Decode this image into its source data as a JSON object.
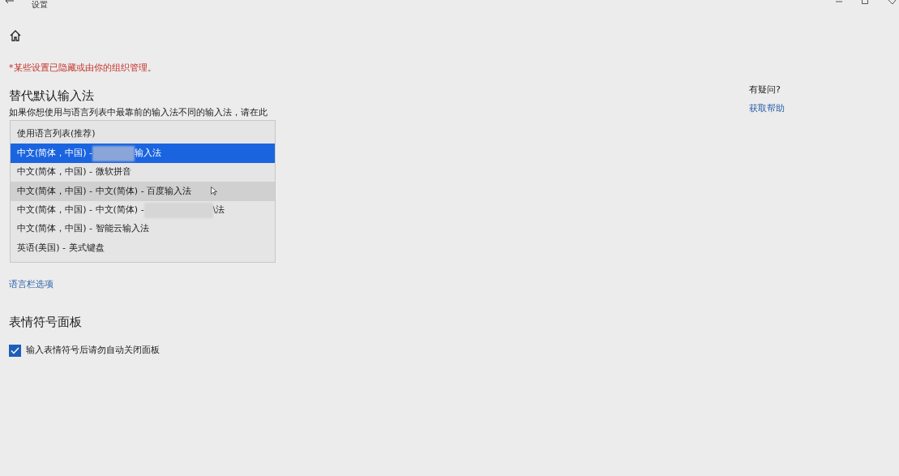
{
  "window": {
    "title": "设置"
  },
  "notice": "*某些设置已隐藏或由你的组织管理。",
  "section_input": {
    "heading": "替代默认输入法",
    "description": "如果你想使用与语言列表中最靠前的输入法不同的输入法，请在此",
    "dropdown": [
      {
        "label": "使用语言列表(推荐)",
        "selected": false,
        "hovered": false,
        "redacted": false
      },
      {
        "label": "中文(简体，中国) -",
        "label_end": "输入法",
        "selected": true,
        "hovered": false,
        "redacted": true
      },
      {
        "label": "中文(简体，中国) - 微软拼音",
        "selected": false,
        "hovered": false,
        "redacted": false
      },
      {
        "label": "中文(简体，中国) - 中文(简体) - 百度输入法",
        "selected": false,
        "hovered": true,
        "redacted": false
      },
      {
        "label": "中文(简体，中国) - 中文(简体) -",
        "label_end": "\\法",
        "selected": false,
        "hovered": false,
        "redacted": true
      },
      {
        "label": "中文(简体，中国) - 智能云输入法",
        "selected": false,
        "hovered": false,
        "redacted": false
      },
      {
        "label": "英语(美国) - 美式键盘",
        "selected": false,
        "hovered": false,
        "redacted": false
      }
    ],
    "link": "语言栏选项"
  },
  "section_emoji": {
    "heading": "表情符号面板",
    "checkbox": {
      "label": "输入表情符号后请勿自动关闭面板",
      "checked": true
    }
  },
  "help": {
    "question": "有疑问?",
    "link": "获取帮助"
  }
}
